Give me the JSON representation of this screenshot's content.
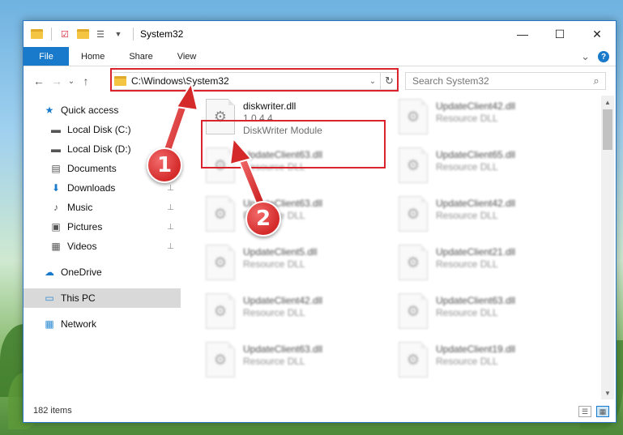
{
  "window": {
    "title": "System32",
    "controls": {
      "minimize": "—",
      "maximize": "☐",
      "close": "✕"
    }
  },
  "ribbon": {
    "tabs": [
      "File",
      "Home",
      "Share",
      "View"
    ],
    "expand_glyph": "⌄",
    "help_glyph": "?"
  },
  "navbar": {
    "back": "←",
    "forward": "→",
    "recent": "⌄",
    "up": "↑",
    "address": "C:\\Windows\\System32",
    "address_dropdown": "⌄",
    "refresh": "↻",
    "search_placeholder": "Search System32",
    "search_glyph": "⌕"
  },
  "sidebar": {
    "quick_access": "Quick access",
    "items": [
      {
        "label": "Local Disk (C:)",
        "icon": "drive-icon",
        "glyph": "▬",
        "pinned": false
      },
      {
        "label": "Local Disk (D:)",
        "icon": "drive-icon",
        "glyph": "▬",
        "pinned": false
      },
      {
        "label": "Documents",
        "icon": "document-icon",
        "glyph": "▤",
        "pinned": false
      },
      {
        "label": "Downloads",
        "icon": "download-icon",
        "glyph": "⬇",
        "pinned": true
      },
      {
        "label": "Music",
        "icon": "music-icon",
        "glyph": "♪",
        "pinned": true
      },
      {
        "label": "Pictures",
        "icon": "picture-icon",
        "glyph": "▣",
        "pinned": true
      },
      {
        "label": "Videos",
        "icon": "video-icon",
        "glyph": "▦",
        "pinned": true
      }
    ],
    "onedrive": "OneDrive",
    "this_pc": "This PC",
    "network": "Network",
    "pin_glyph": "📌"
  },
  "files": {
    "main": {
      "name": "diskwriter.dll",
      "version": "1.0.4.4",
      "description": "DiskWriter Module"
    },
    "blurred": [
      {
        "name": "UpdateClient42.dll",
        "type": "Resource DLL"
      },
      {
        "name": "UpdateClient63.dll",
        "type": "Resource DLL"
      },
      {
        "name": "UpdateClient65.dll",
        "type": "Resource DLL"
      },
      {
        "name": "UpdateClient63.dll",
        "type": "Resource DLL"
      },
      {
        "name": "UpdateClient42.dll",
        "type": "Resource DLL"
      },
      {
        "name": "UpdateClient5.dll",
        "type": "Resource DLL"
      },
      {
        "name": "UpdateClient21.dll",
        "type": "Resource DLL"
      },
      {
        "name": "UpdateClient42.dll",
        "type": "Resource DLL"
      },
      {
        "name": "UpdateClient63.dll",
        "type": "Resource DLL"
      },
      {
        "name": "UpdateClient63.dll",
        "type": "Resource DLL"
      },
      {
        "name": "UpdateClient19.dll",
        "type": "Resource DLL"
      }
    ],
    "file_glyph": "⚙"
  },
  "status": {
    "count": "182 items"
  },
  "callouts": {
    "one": "1",
    "two": "2"
  },
  "colors": {
    "accent": "#1979ca",
    "highlight": "#d9232d"
  }
}
